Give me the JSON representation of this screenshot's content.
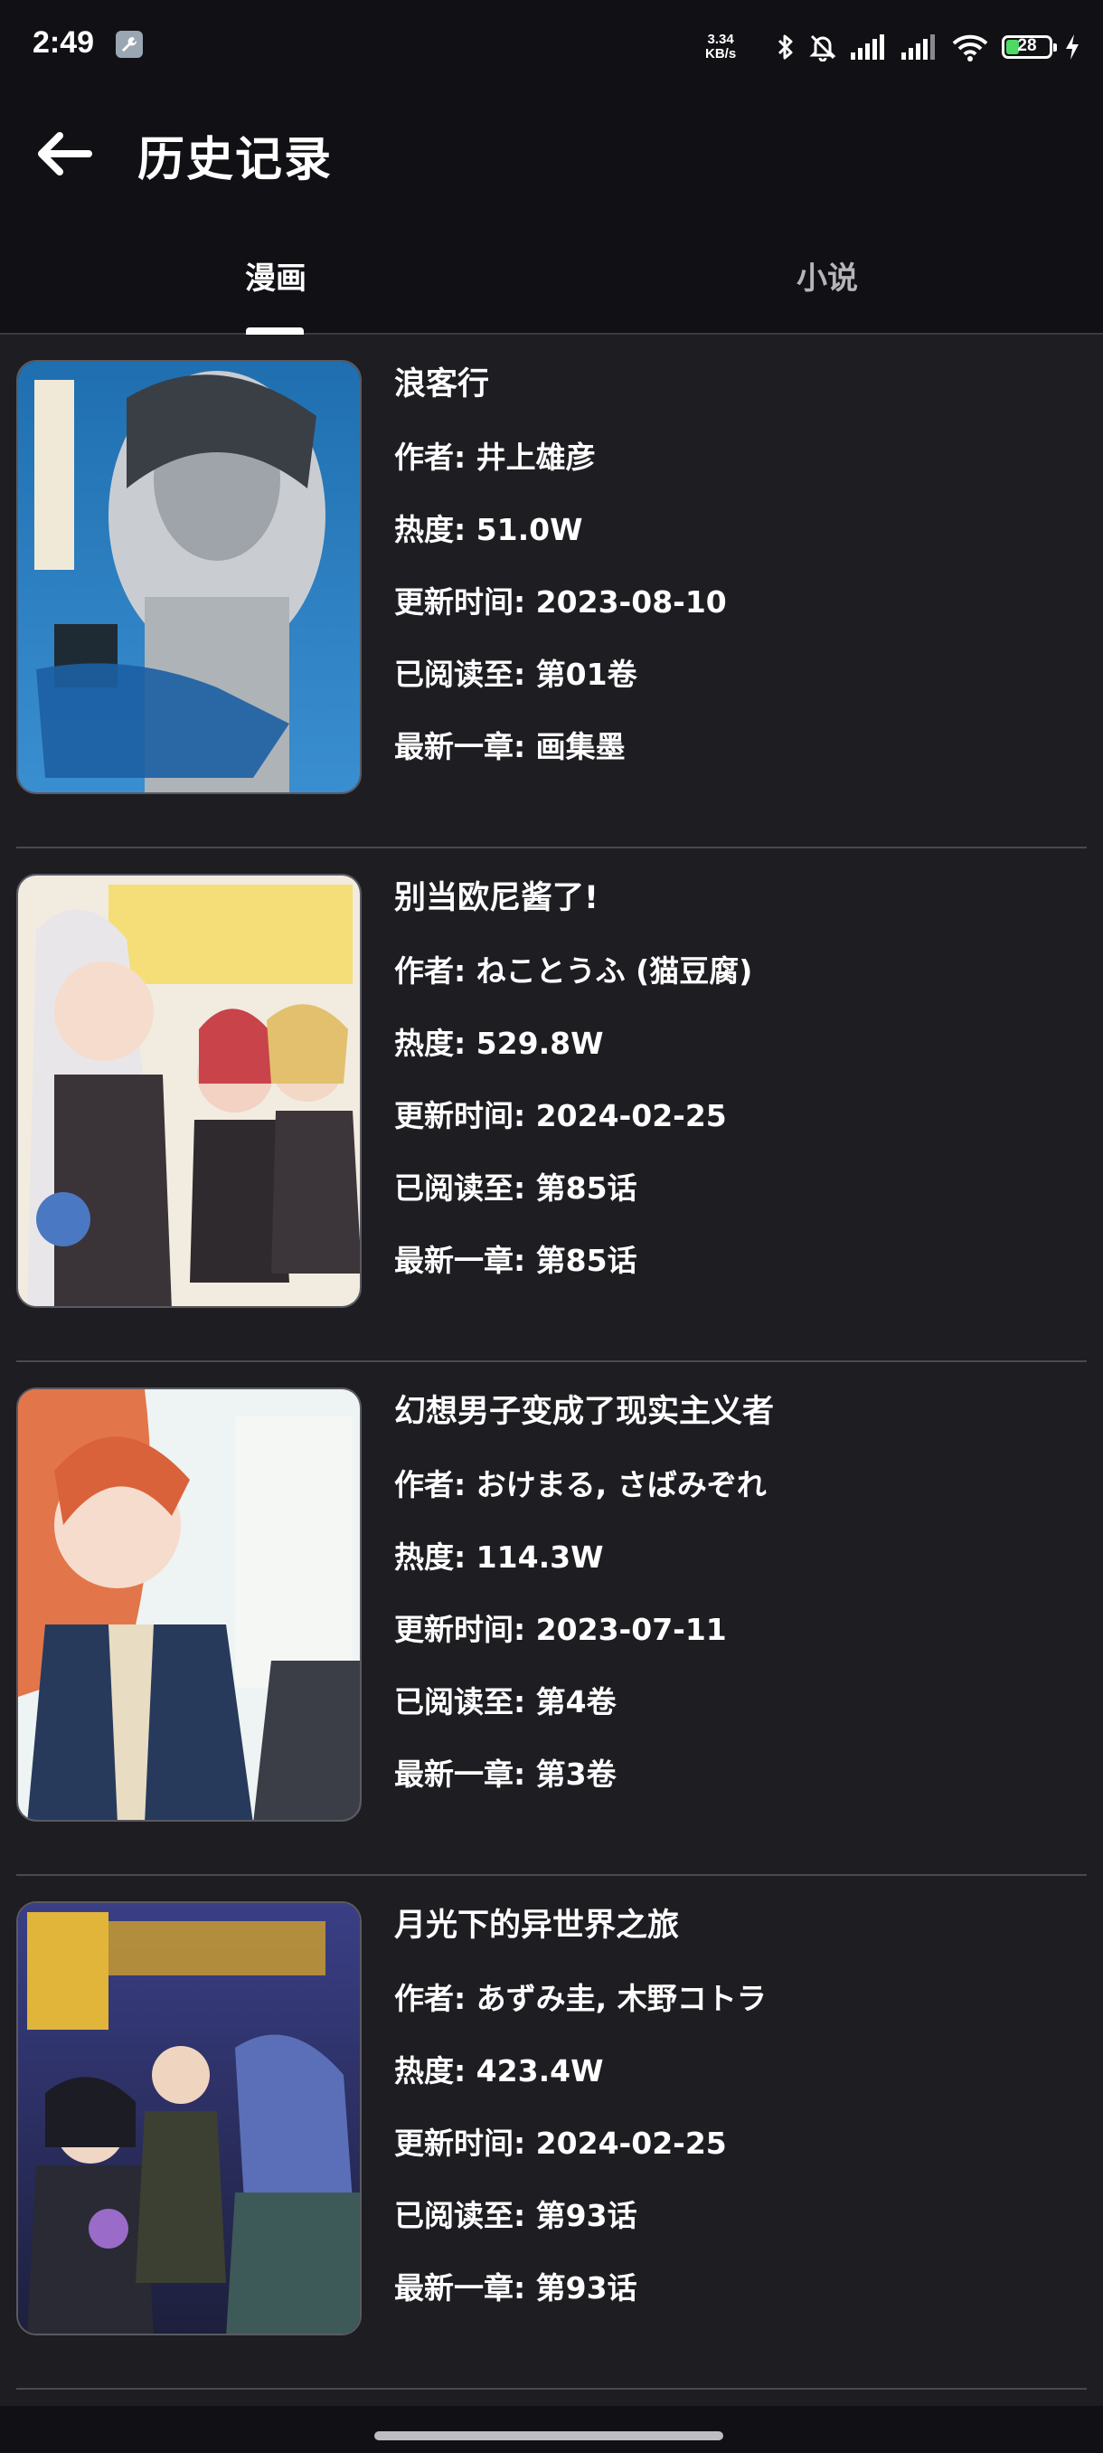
{
  "status_bar": {
    "time": "2:49",
    "net_speed_value": "3.34",
    "net_speed_unit": "KB/s",
    "battery_level": "28",
    "icons": [
      "wrench-app-icon",
      "bluetooth-icon",
      "bell-off-icon",
      "signal-icon",
      "signal-icon",
      "wifi-icon",
      "battery-icon",
      "charging-bolt-icon"
    ]
  },
  "app_bar": {
    "back_icon": "arrow-left-icon",
    "title": "历史记录"
  },
  "tabs": [
    {
      "label": "漫画",
      "active": true
    },
    {
      "label": "小说",
      "active": false
    }
  ],
  "items": [
    {
      "title": "浪客行",
      "author": "作者: 井上雄彦",
      "popularity": "热度: 51.0W",
      "updated": "更新时间: 2023-08-10",
      "read_to": "已阅读至: 第01卷",
      "latest": "最新一章: 画集墨",
      "cover_colors": [
        "#2a7ab8",
        "#d8dde2"
      ]
    },
    {
      "title": "别当欧尼酱了!",
      "author": "作者: ねことうふ (猫豆腐)",
      "popularity": "热度: 529.8W",
      "updated": "更新时间: 2024-02-25",
      "read_to": "已阅读至: 第85话",
      "latest": "最新一章: 第85话",
      "cover_colors": [
        "#f2ebe0",
        "#c8444a"
      ]
    },
    {
      "title": "幻想男子变成了现实主义者",
      "author": "作者: おけまる, さばみぞれ",
      "popularity": "热度: 114.3W",
      "updated": "更新时间: 2023-07-11",
      "read_to": "已阅读至: 第4卷",
      "latest": "最新一章: 第3卷",
      "cover_colors": [
        "#eef3f3",
        "#e2764a"
      ]
    },
    {
      "title": "月光下的异世界之旅",
      "author": "作者: あずみ圭, 木野コトラ",
      "popularity": "热度: 423.4W",
      "updated": "更新时间: 2024-02-25",
      "read_to": "已阅读至: 第93话",
      "latest": "最新一章: 第93话",
      "cover_colors": [
        "#2b2f6a",
        "#d8b040"
      ]
    }
  ]
}
